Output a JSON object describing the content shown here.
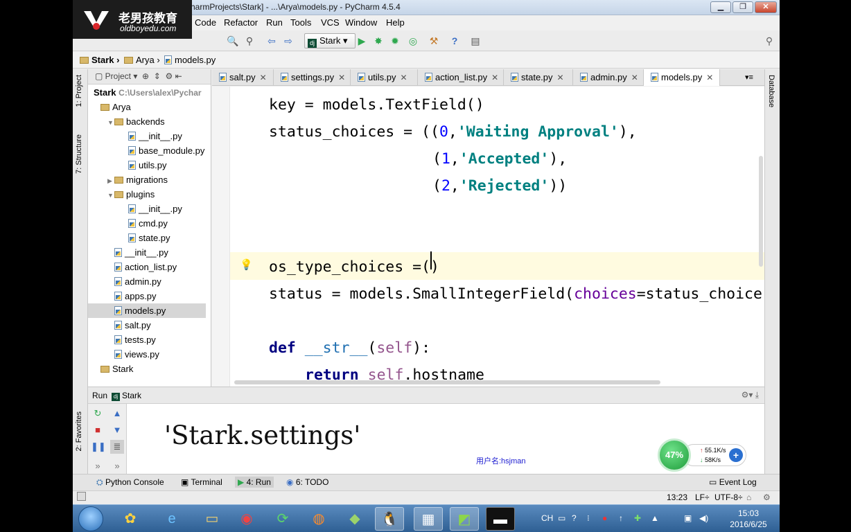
{
  "window": {
    "title": "harmProjects\\Stark] - ...\\Arya\\models.py - PyCharm 4.5.4",
    "minimize": "▁",
    "maximize": "❐",
    "close": "✕"
  },
  "logo": {
    "cn": "老男孩教育",
    "url": "oldboyedu.com"
  },
  "menu": [
    "Code",
    "Refactor",
    "Run",
    "Tools",
    "VCS",
    "Window",
    "Help"
  ],
  "toolbar": {
    "run_config": "Stark"
  },
  "breadcrumb": [
    "Stark",
    "Arya",
    "models.py"
  ],
  "project_panel": {
    "header": "Project",
    "root": "Stark",
    "root_path": "C:\\Users\\alex\\Pychar",
    "tree": [
      {
        "label": "Arya",
        "kind": "folder",
        "indent": 0,
        "arrow": ""
      },
      {
        "label": "backends",
        "kind": "folder",
        "indent": 1,
        "arrow": "▼"
      },
      {
        "label": "__init__.py",
        "kind": "py",
        "indent": 2,
        "arrow": ""
      },
      {
        "label": "base_module.py",
        "kind": "py",
        "indent": 2,
        "arrow": ""
      },
      {
        "label": "utils.py",
        "kind": "py",
        "indent": 2,
        "arrow": ""
      },
      {
        "label": "migrations",
        "kind": "folder",
        "indent": 1,
        "arrow": "▶"
      },
      {
        "label": "plugins",
        "kind": "folder",
        "indent": 1,
        "arrow": "▼"
      },
      {
        "label": "__init__.py",
        "kind": "py",
        "indent": 2,
        "arrow": ""
      },
      {
        "label": "cmd.py",
        "kind": "py",
        "indent": 2,
        "arrow": ""
      },
      {
        "label": "state.py",
        "kind": "py",
        "indent": 2,
        "arrow": ""
      },
      {
        "label": "__init__.py",
        "kind": "py",
        "indent": 1,
        "arrow": ""
      },
      {
        "label": "action_list.py",
        "kind": "py",
        "indent": 1,
        "arrow": ""
      },
      {
        "label": "admin.py",
        "kind": "py",
        "indent": 1,
        "arrow": ""
      },
      {
        "label": "apps.py",
        "kind": "py",
        "indent": 1,
        "arrow": ""
      },
      {
        "label": "models.py",
        "kind": "py",
        "indent": 1,
        "arrow": "",
        "selected": true
      },
      {
        "label": "salt.py",
        "kind": "py",
        "indent": 1,
        "arrow": ""
      },
      {
        "label": "tests.py",
        "kind": "py",
        "indent": 1,
        "arrow": ""
      },
      {
        "label": "views.py",
        "kind": "py",
        "indent": 1,
        "arrow": ""
      },
      {
        "label": "Stark",
        "kind": "folder",
        "indent": 0,
        "arrow": ""
      }
    ]
  },
  "tabs": [
    "salt.py",
    "settings.py",
    "utils.py",
    "action_list.py",
    "state.py",
    "admin.py",
    "models.py"
  ],
  "active_tab": "models.py",
  "editor": {
    "lines": [
      "key = models.TextField()",
      "status_choices = ((0,'Waiting Approval'),",
      "(1,'Accepted'),",
      "(2,'Rejected'))",
      "os_type_choices =()",
      "status = models.SmallIntegerField(choices=status_choice",
      "def __str__(self):",
      "return self.hostname"
    ]
  },
  "side_tabs": {
    "project": "1: Project",
    "structure": "7: Structure",
    "favorites": "2: Favorites",
    "database": "Database"
  },
  "run_panel": {
    "title": "Run",
    "config": "Stark",
    "output": "'Stark.settings'",
    "username": "用户名:hsjman"
  },
  "network_widget": {
    "percent": "47%",
    "upload": "55.1K/s",
    "download": "58K/s"
  },
  "bottom_tabs": [
    "Python Console",
    "Terminal",
    "4: Run",
    "6: TODO"
  ],
  "event_log": "Event Log",
  "status_bar": {
    "position": "13:23",
    "line_sep": "LF÷",
    "encoding": "UTF-8÷"
  },
  "taskbar": {
    "lang": "CH",
    "time": "15:03",
    "date": "2016/6/25"
  }
}
